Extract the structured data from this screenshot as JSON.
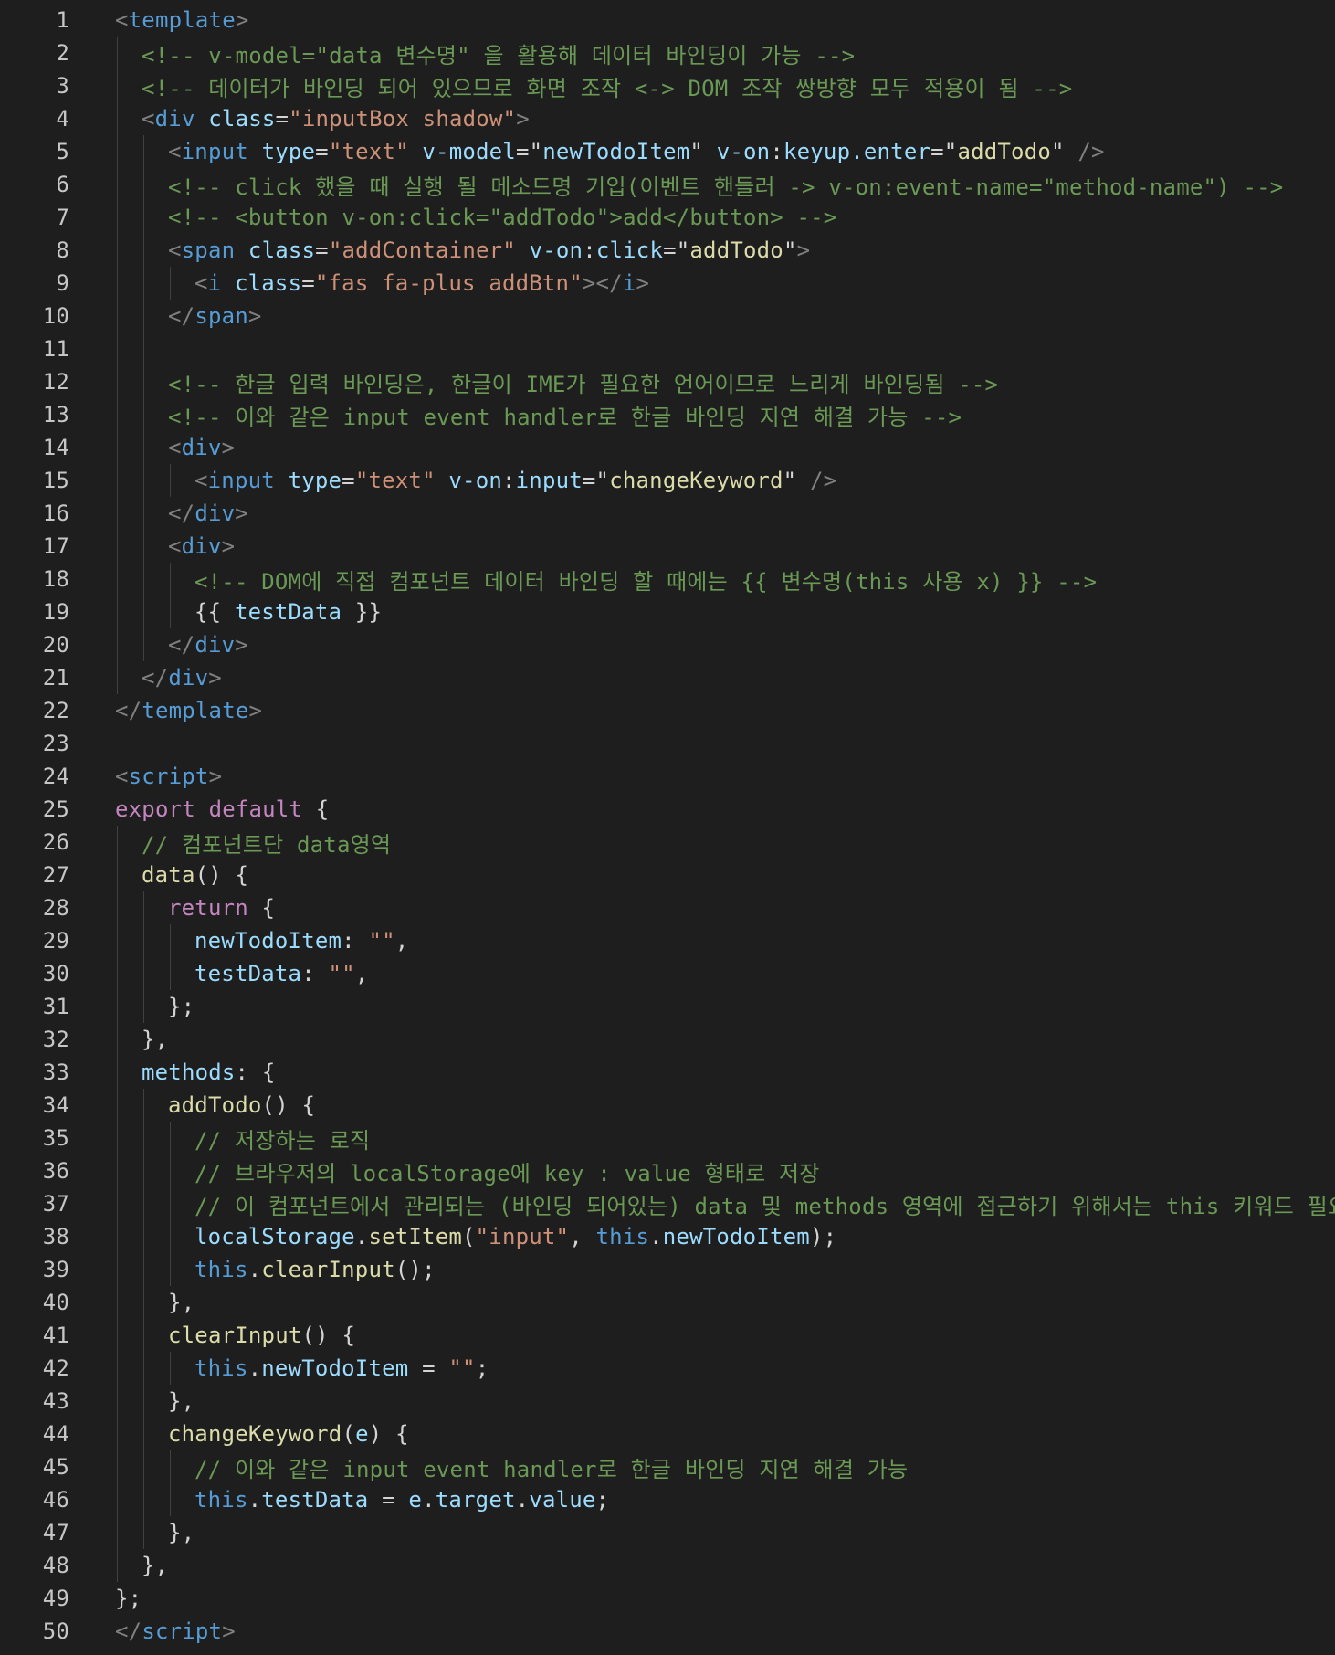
{
  "editor": {
    "theme": {
      "background": "#1e1e1e",
      "line_number": "#c6c6c6",
      "comment": "#6a9955",
      "tag": "#569cd6",
      "attribute": "#9cdcfe",
      "string": "#ce9178",
      "keyword": "#c586c0",
      "function": "#dcdcaa",
      "plain": "#d4d4d4",
      "punctuation": "#808080"
    },
    "lines": [
      {
        "n": "1",
        "indent": 0,
        "tokens": [
          [
            "punct",
            "<"
          ],
          [
            "tag",
            "template"
          ],
          [
            "punct",
            ">"
          ]
        ]
      },
      {
        "n": "2",
        "indent": 1,
        "tokens": [
          [
            "comment",
            "<!-- v-model=\"data 변수명\" 을 활용해 데이터 바인딩이 가능 -->"
          ]
        ]
      },
      {
        "n": "3",
        "indent": 1,
        "tokens": [
          [
            "comment",
            "<!-- 데이터가 바인딩 되어 있으므로 화면 조작 <-> DOM 조작 쌍방향 모두 적용이 됨 -->"
          ]
        ]
      },
      {
        "n": "4",
        "indent": 1,
        "tokens": [
          [
            "punct",
            "<"
          ],
          [
            "tag",
            "div"
          ],
          [
            "plain",
            " "
          ],
          [
            "attr",
            "class"
          ],
          [
            "plain",
            "="
          ],
          [
            "str",
            "\"inputBox shadow\""
          ],
          [
            "punct",
            ">"
          ]
        ]
      },
      {
        "n": "5",
        "indent": 2,
        "tokens": [
          [
            "punct",
            "<"
          ],
          [
            "tag",
            "input"
          ],
          [
            "plain",
            " "
          ],
          [
            "attr",
            "type"
          ],
          [
            "plain",
            "="
          ],
          [
            "str",
            "\"text\""
          ],
          [
            "plain",
            " "
          ],
          [
            "attr",
            "v-model"
          ],
          [
            "plain",
            "=\""
          ],
          [
            "attr",
            "newTodoItem"
          ],
          [
            "plain",
            "\" "
          ],
          [
            "attr",
            "v-on"
          ],
          [
            "plain",
            ":"
          ],
          [
            "attr",
            "keyup.enter"
          ],
          [
            "plain",
            "=\""
          ],
          [
            "func",
            "addTodo"
          ],
          [
            "plain",
            "\" "
          ],
          [
            "punct",
            "/>"
          ]
        ]
      },
      {
        "n": "6",
        "indent": 2,
        "tokens": [
          [
            "comment",
            "<!-- click 했을 때 실행 될 메소드명 기입(이벤트 핸들러 -> v-on:event-name=\"method-name\") -->"
          ]
        ]
      },
      {
        "n": "7",
        "indent": 2,
        "tokens": [
          [
            "comment",
            "<!-- <button v-on:click=\"addTodo\">add</button> -->"
          ]
        ]
      },
      {
        "n": "8",
        "indent": 2,
        "tokens": [
          [
            "punct",
            "<"
          ],
          [
            "tag",
            "span"
          ],
          [
            "plain",
            " "
          ],
          [
            "attr",
            "class"
          ],
          [
            "plain",
            "="
          ],
          [
            "str",
            "\"addContainer\""
          ],
          [
            "plain",
            " "
          ],
          [
            "attr",
            "v-on"
          ],
          [
            "plain",
            ":"
          ],
          [
            "attr",
            "click"
          ],
          [
            "plain",
            "=\""
          ],
          [
            "func",
            "addTodo"
          ],
          [
            "plain",
            "\""
          ],
          [
            "punct",
            ">"
          ]
        ]
      },
      {
        "n": "9",
        "indent": 3,
        "tokens": [
          [
            "punct",
            "<"
          ],
          [
            "tag",
            "i"
          ],
          [
            "plain",
            " "
          ],
          [
            "attr",
            "class"
          ],
          [
            "plain",
            "="
          ],
          [
            "str",
            "\"fas fa-plus addBtn\""
          ],
          [
            "punct",
            "></"
          ],
          [
            "tag",
            "i"
          ],
          [
            "punct",
            ">"
          ]
        ]
      },
      {
        "n": "10",
        "indent": 2,
        "tokens": [
          [
            "punct",
            "</"
          ],
          [
            "tag",
            "span"
          ],
          [
            "punct",
            ">"
          ]
        ]
      },
      {
        "n": "11",
        "indent": 2,
        "tokens": []
      },
      {
        "n": "12",
        "indent": 2,
        "tokens": [
          [
            "comment",
            "<!-- 한글 입력 바인딩은, 한글이 IME가 필요한 언어이므로 느리게 바인딩됨 -->"
          ]
        ]
      },
      {
        "n": "13",
        "indent": 2,
        "tokens": [
          [
            "comment",
            "<!-- 이와 같은 input event handler로 한글 바인딩 지연 해결 가능 -->"
          ]
        ]
      },
      {
        "n": "14",
        "indent": 2,
        "tokens": [
          [
            "punct",
            "<"
          ],
          [
            "tag",
            "div"
          ],
          [
            "punct",
            ">"
          ]
        ]
      },
      {
        "n": "15",
        "indent": 3,
        "tokens": [
          [
            "punct",
            "<"
          ],
          [
            "tag",
            "input"
          ],
          [
            "plain",
            " "
          ],
          [
            "attr",
            "type"
          ],
          [
            "plain",
            "="
          ],
          [
            "str",
            "\"text\""
          ],
          [
            "plain",
            " "
          ],
          [
            "attr",
            "v-on"
          ],
          [
            "plain",
            ":"
          ],
          [
            "attr",
            "input"
          ],
          [
            "plain",
            "=\""
          ],
          [
            "func",
            "changeKeyword"
          ],
          [
            "plain",
            "\" "
          ],
          [
            "punct",
            "/>"
          ]
        ]
      },
      {
        "n": "16",
        "indent": 2,
        "tokens": [
          [
            "punct",
            "</"
          ],
          [
            "tag",
            "div"
          ],
          [
            "punct",
            ">"
          ]
        ]
      },
      {
        "n": "17",
        "indent": 2,
        "tokens": [
          [
            "punct",
            "<"
          ],
          [
            "tag",
            "div"
          ],
          [
            "punct",
            ">"
          ]
        ]
      },
      {
        "n": "18",
        "indent": 3,
        "tokens": [
          [
            "comment",
            "<!-- DOM에 직접 컴포넌트 데이터 바인딩 할 때에는 {{ 변수명(this 사용 x) }} -->"
          ]
        ]
      },
      {
        "n": "19",
        "indent": 3,
        "tokens": [
          [
            "plain",
            "{{ "
          ],
          [
            "var",
            "testData"
          ],
          [
            "plain",
            " }}"
          ]
        ]
      },
      {
        "n": "20",
        "indent": 2,
        "tokens": [
          [
            "punct",
            "</"
          ],
          [
            "tag",
            "div"
          ],
          [
            "punct",
            ">"
          ]
        ]
      },
      {
        "n": "21",
        "indent": 1,
        "tokens": [
          [
            "punct",
            "</"
          ],
          [
            "tag",
            "div"
          ],
          [
            "punct",
            ">"
          ]
        ]
      },
      {
        "n": "22",
        "indent": 0,
        "tokens": [
          [
            "punct",
            "</"
          ],
          [
            "tag",
            "template"
          ],
          [
            "punct",
            ">"
          ]
        ]
      },
      {
        "n": "23",
        "indent": 0,
        "tokens": []
      },
      {
        "n": "24",
        "indent": 0,
        "tokens": [
          [
            "punct",
            "<"
          ],
          [
            "tag",
            "script"
          ],
          [
            "punct",
            ">"
          ]
        ]
      },
      {
        "n": "25",
        "indent": 0,
        "tokens": [
          [
            "keyword",
            "export"
          ],
          [
            "plain",
            " "
          ],
          [
            "keyword",
            "default"
          ],
          [
            "plain",
            " {"
          ]
        ]
      },
      {
        "n": "26",
        "indent": 1,
        "tokens": [
          [
            "comment",
            "// 컴포넌트단 data영역"
          ]
        ]
      },
      {
        "n": "27",
        "indent": 1,
        "tokens": [
          [
            "func",
            "data"
          ],
          [
            "plain",
            "() {"
          ]
        ]
      },
      {
        "n": "28",
        "indent": 2,
        "tokens": [
          [
            "keyword",
            "return"
          ],
          [
            "plain",
            " {"
          ]
        ]
      },
      {
        "n": "29",
        "indent": 3,
        "tokens": [
          [
            "var",
            "newTodoItem"
          ],
          [
            "plain",
            ": "
          ],
          [
            "str",
            "\"\""
          ],
          [
            "plain",
            ","
          ]
        ]
      },
      {
        "n": "30",
        "indent": 3,
        "tokens": [
          [
            "var",
            "testData"
          ],
          [
            "plain",
            ": "
          ],
          [
            "str",
            "\"\""
          ],
          [
            "plain",
            ","
          ]
        ]
      },
      {
        "n": "31",
        "indent": 2,
        "tokens": [
          [
            "plain",
            "};"
          ]
        ]
      },
      {
        "n": "32",
        "indent": 1,
        "tokens": [
          [
            "plain",
            "},"
          ]
        ]
      },
      {
        "n": "33",
        "indent": 1,
        "tokens": [
          [
            "var",
            "methods"
          ],
          [
            "plain",
            ": {"
          ]
        ]
      },
      {
        "n": "34",
        "indent": 2,
        "tokens": [
          [
            "func",
            "addTodo"
          ],
          [
            "plain",
            "() {"
          ]
        ]
      },
      {
        "n": "35",
        "indent": 3,
        "tokens": [
          [
            "comment",
            "// 저장하는 로직"
          ]
        ]
      },
      {
        "n": "36",
        "indent": 3,
        "tokens": [
          [
            "comment",
            "// 브라우저의 localStorage에 key : value 형태로 저장"
          ]
        ]
      },
      {
        "n": "37",
        "indent": 3,
        "tokens": [
          [
            "comment",
            "// 이 컴포넌트에서 관리되는 (바인딩 되어있는) data 및 methods 영역에 접근하기 위해서는 this 키워드 필요"
          ]
        ]
      },
      {
        "n": "38",
        "indent": 3,
        "tokens": [
          [
            "var",
            "localStorage"
          ],
          [
            "plain",
            "."
          ],
          [
            "func",
            "setItem"
          ],
          [
            "plain",
            "("
          ],
          [
            "str",
            "\"input\""
          ],
          [
            "plain",
            ", "
          ],
          [
            "kw2",
            "this"
          ],
          [
            "plain",
            "."
          ],
          [
            "var",
            "newTodoItem"
          ],
          [
            "plain",
            ");"
          ]
        ]
      },
      {
        "n": "39",
        "indent": 3,
        "tokens": [
          [
            "kw2",
            "this"
          ],
          [
            "plain",
            "."
          ],
          [
            "func",
            "clearInput"
          ],
          [
            "plain",
            "();"
          ]
        ]
      },
      {
        "n": "40",
        "indent": 2,
        "tokens": [
          [
            "plain",
            "},"
          ]
        ]
      },
      {
        "n": "41",
        "indent": 2,
        "tokens": [
          [
            "func",
            "clearInput"
          ],
          [
            "plain",
            "() {"
          ]
        ]
      },
      {
        "n": "42",
        "indent": 3,
        "tokens": [
          [
            "kw2",
            "this"
          ],
          [
            "plain",
            "."
          ],
          [
            "var",
            "newTodoItem"
          ],
          [
            "plain",
            " = "
          ],
          [
            "str",
            "\"\""
          ],
          [
            "plain",
            ";"
          ]
        ]
      },
      {
        "n": "43",
        "indent": 2,
        "tokens": [
          [
            "plain",
            "},"
          ]
        ]
      },
      {
        "n": "44",
        "indent": 2,
        "tokens": [
          [
            "func",
            "changeKeyword"
          ],
          [
            "plain",
            "("
          ],
          [
            "var",
            "e"
          ],
          [
            "plain",
            ") {"
          ]
        ]
      },
      {
        "n": "45",
        "indent": 3,
        "tokens": [
          [
            "comment",
            "// 이와 같은 input event handler로 한글 바인딩 지연 해결 가능"
          ]
        ]
      },
      {
        "n": "46",
        "indent": 3,
        "tokens": [
          [
            "kw2",
            "this"
          ],
          [
            "plain",
            "."
          ],
          [
            "var",
            "testData"
          ],
          [
            "plain",
            " = "
          ],
          [
            "var",
            "e"
          ],
          [
            "plain",
            "."
          ],
          [
            "var",
            "target"
          ],
          [
            "plain",
            "."
          ],
          [
            "var",
            "value"
          ],
          [
            "plain",
            ";"
          ]
        ]
      },
      {
        "n": "47",
        "indent": 2,
        "tokens": [
          [
            "plain",
            "},"
          ]
        ]
      },
      {
        "n": "48",
        "indent": 1,
        "tokens": [
          [
            "plain",
            "},"
          ]
        ]
      },
      {
        "n": "49",
        "indent": 0,
        "tokens": [
          [
            "plain",
            "};"
          ]
        ]
      },
      {
        "n": "50",
        "indent": 0,
        "tokens": [
          [
            "punct",
            "</"
          ],
          [
            "tag",
            "script"
          ],
          [
            "punct",
            ">"
          ]
        ]
      }
    ]
  }
}
